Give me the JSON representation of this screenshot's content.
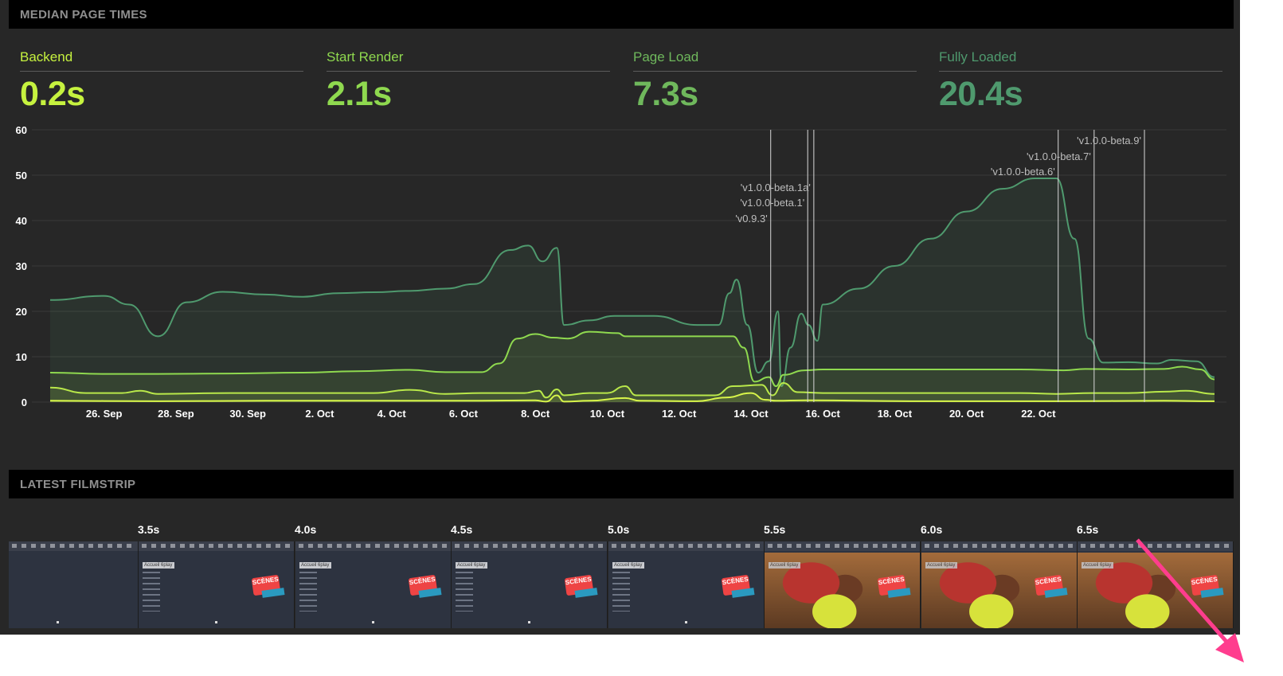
{
  "sections": {
    "median_title": "MEDIAN PAGE TIMES",
    "filmstrip_title": "LATEST FILMSTRIP"
  },
  "metrics": [
    {
      "label": "Backend",
      "value": "0.2s",
      "color": "#c6f23f"
    },
    {
      "label": "Start Render",
      "value": "2.1s",
      "color": "#8fd94f"
    },
    {
      "label": "Page Load",
      "value": "7.3s",
      "color": "#6fb85c"
    },
    {
      "label": "Fully Loaded",
      "value": "20.4s",
      "color": "#4f9a6e"
    }
  ],
  "chart_data": {
    "type": "area",
    "title": "",
    "xlabel": "",
    "ylabel": "",
    "ylim": [
      0,
      60
    ],
    "yticks": [
      0,
      10,
      20,
      30,
      40,
      50,
      60
    ],
    "xticks": [
      "26. Sep",
      "28. Sep",
      "30. Sep",
      "2. Oct",
      "4. Oct",
      "6. Oct",
      "8. Oct",
      "10. Oct",
      "12. Oct",
      "14. Oct",
      "16. Oct",
      "18. Oct",
      "20. Oct",
      "22. Oct"
    ],
    "grid": true,
    "series": [
      {
        "key": "fully_loaded",
        "color": "#4f9a6e",
        "points": [
          [
            0,
            22.5
          ],
          [
            1.5,
            23.4
          ],
          [
            2.2,
            21.5
          ],
          [
            3,
            14.5
          ],
          [
            3.8,
            22
          ],
          [
            4.8,
            24.3
          ],
          [
            6,
            23.7
          ],
          [
            7,
            23.2
          ],
          [
            8,
            24
          ],
          [
            9,
            24.2
          ],
          [
            10,
            24.5
          ],
          [
            11,
            25
          ],
          [
            11.8,
            26
          ],
          [
            12.8,
            33.5
          ],
          [
            13.3,
            34.5
          ],
          [
            13.7,
            31
          ],
          [
            14.1,
            34
          ],
          [
            14.3,
            17
          ],
          [
            15,
            18
          ],
          [
            15.7,
            19
          ],
          [
            16.8,
            19
          ],
          [
            18,
            17
          ],
          [
            18.6,
            17
          ],
          [
            18.9,
            24
          ],
          [
            19.1,
            27
          ],
          [
            19.4,
            17
          ],
          [
            19.7,
            6.5
          ],
          [
            20.0,
            9
          ],
          [
            20.25,
            20
          ],
          [
            20.35,
            3.5
          ],
          [
            20.6,
            12
          ],
          [
            20.9,
            19.5
          ],
          [
            21.1,
            17
          ],
          [
            21.35,
            13.5
          ],
          [
            21.5,
            21.5
          ],
          [
            22.5,
            25
          ],
          [
            23.5,
            30
          ],
          [
            24.5,
            36
          ],
          [
            25.5,
            42
          ],
          [
            26.5,
            47
          ],
          [
            27.4,
            49.3
          ],
          [
            28.0,
            49.3
          ],
          [
            28.5,
            36
          ],
          [
            28.9,
            14
          ],
          [
            29.3,
            8.7
          ],
          [
            30,
            8.8
          ],
          [
            30.8,
            8.5
          ],
          [
            31.2,
            9.3
          ],
          [
            31.9,
            9
          ],
          [
            32.4,
            5.5
          ]
        ]
      },
      {
        "key": "page_load",
        "color": "#8fd94f",
        "points": [
          [
            0,
            6.5
          ],
          [
            1.5,
            6.2
          ],
          [
            3,
            6.2
          ],
          [
            5,
            6.3
          ],
          [
            7,
            6.5
          ],
          [
            8.5,
            6.8
          ],
          [
            10,
            7.1
          ],
          [
            11,
            6.6
          ],
          [
            12,
            6.6
          ],
          [
            12.5,
            8.5
          ],
          [
            13,
            14
          ],
          [
            13.5,
            15
          ],
          [
            14,
            14.2
          ],
          [
            14.4,
            14
          ],
          [
            15,
            15.5
          ],
          [
            15.8,
            15.2
          ],
          [
            16,
            14.5
          ],
          [
            18,
            14.5
          ],
          [
            19.0,
            14.5
          ],
          [
            19.3,
            12
          ],
          [
            19.6,
            4.5
          ],
          [
            20.0,
            5.5
          ],
          [
            20.2,
            3.5
          ],
          [
            20.4,
            6
          ],
          [
            21.0,
            7
          ],
          [
            21.5,
            7.2
          ],
          [
            23,
            7.2
          ],
          [
            25,
            7.2
          ],
          [
            27,
            7.2
          ],
          [
            28.2,
            7.0
          ],
          [
            28.8,
            7.3
          ],
          [
            30,
            7.2
          ],
          [
            31,
            7.3
          ],
          [
            31.5,
            7.8
          ],
          [
            32,
            7.2
          ],
          [
            32.4,
            5
          ]
        ]
      },
      {
        "key": "start_render",
        "color": "#b9e84a",
        "points": [
          [
            0,
            3.2
          ],
          [
            1,
            2
          ],
          [
            2,
            2
          ],
          [
            2.5,
            2.5
          ],
          [
            3,
            1.8
          ],
          [
            5,
            2
          ],
          [
            7,
            2
          ],
          [
            9,
            2
          ],
          [
            10,
            2.7
          ],
          [
            11,
            1.8
          ],
          [
            12,
            2
          ],
          [
            13.2,
            2
          ],
          [
            13.6,
            2.5
          ],
          [
            13.8,
            1
          ],
          [
            14.1,
            2.8
          ],
          [
            14.3,
            1.5
          ],
          [
            15,
            2
          ],
          [
            15.5,
            2
          ],
          [
            16,
            3.5
          ],
          [
            16.3,
            1.5
          ],
          [
            17,
            1.5
          ],
          [
            18.5,
            1.5
          ],
          [
            19.0,
            3.5
          ],
          [
            19.8,
            3.8
          ],
          [
            20.1,
            1.5
          ],
          [
            20.4,
            4.2
          ],
          [
            20.8,
            2.2
          ],
          [
            21.5,
            2
          ],
          [
            24,
            2
          ],
          [
            27,
            2
          ],
          [
            28,
            1.8
          ],
          [
            29,
            2
          ],
          [
            30,
            2
          ],
          [
            31,
            2.3
          ],
          [
            31.6,
            2.5
          ],
          [
            32.4,
            1.8
          ]
        ]
      },
      {
        "key": "backend",
        "color": "#d8f54a",
        "points": [
          [
            0,
            0.3
          ],
          [
            3,
            0.2
          ],
          [
            6,
            0.3
          ],
          [
            9,
            0.3
          ],
          [
            12,
            0.3
          ],
          [
            13.5,
            0.4
          ],
          [
            13.8,
            0.1
          ],
          [
            14.1,
            1.5
          ],
          [
            14.3,
            0.1
          ],
          [
            15,
            0.3
          ],
          [
            16,
            0.9
          ],
          [
            16.4,
            0.3
          ],
          [
            18,
            0.2
          ],
          [
            18.8,
            1
          ],
          [
            19.5,
            2
          ],
          [
            19.9,
            0.5
          ],
          [
            20.2,
            0.3
          ],
          [
            21,
            0.4
          ],
          [
            24,
            0.2
          ],
          [
            28,
            0.2
          ],
          [
            31,
            0.3
          ],
          [
            32.4,
            0.2
          ]
        ]
      }
    ],
    "annotations": [
      {
        "x": 20.05,
        "label": "'v0.9.3'"
      },
      {
        "x": 21.08,
        "label": "'v1.0.0-beta.1'"
      },
      {
        "x": 21.25,
        "label": "'v1.0.0-beta.1a'"
      },
      {
        "x": 28.05,
        "label": "'v1.0.0-beta.6'"
      },
      {
        "x": 29.05,
        "label": "'v1.0.0-beta.7'"
      },
      {
        "x": 30.45,
        "label": "'v1.0.0-beta.9'"
      }
    ]
  },
  "filmstrip": {
    "frames": [
      {
        "label": "",
        "kind": "blank"
      },
      {
        "label": "3.5s",
        "kind": "site"
      },
      {
        "label": "4.0s",
        "kind": "site"
      },
      {
        "label": "4.5s",
        "kind": "site"
      },
      {
        "label": "5.0s",
        "kind": "site"
      },
      {
        "label": "5.5s",
        "kind": "photo"
      },
      {
        "label": "6.0s",
        "kind": "photo"
      },
      {
        "label": "6.5s",
        "kind": "photo"
      }
    ],
    "site_menu_label": "Accueil 6play",
    "logo_text": "SCÈNES"
  },
  "annotation_arrow_color": "#ff3d8e"
}
